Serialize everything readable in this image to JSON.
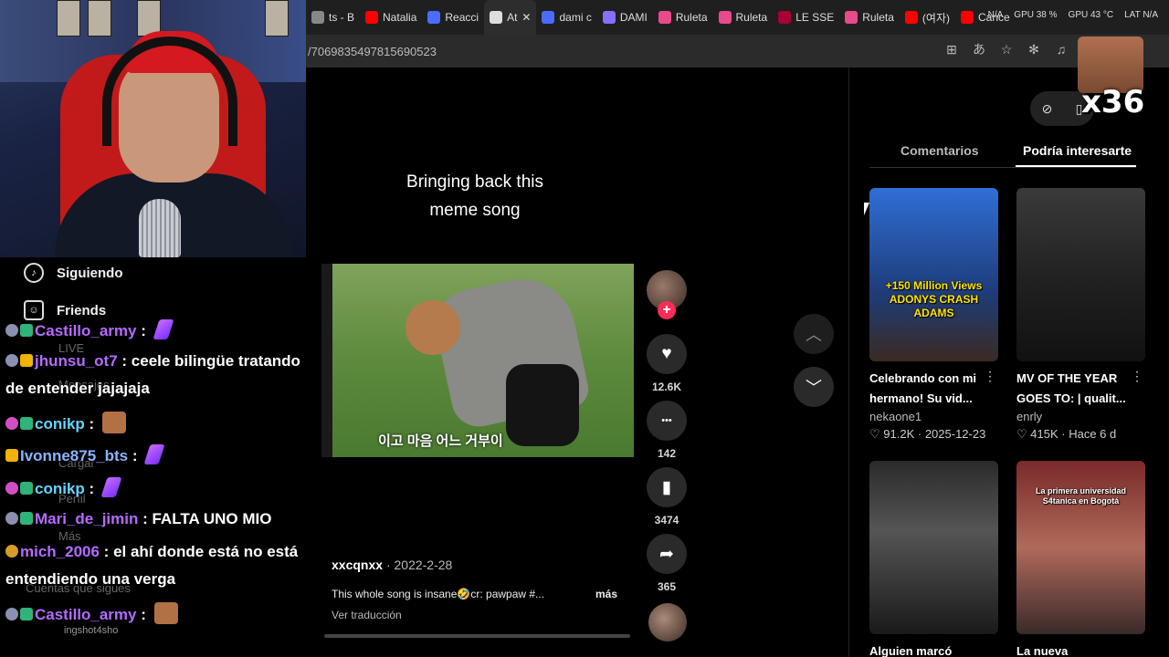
{
  "browser": {
    "tabs": [
      {
        "label": "ts - B",
        "color": "#888888"
      },
      {
        "label": "Natalia",
        "color": "#ff0000"
      },
      {
        "label": "Reacci",
        "color": "#4a6cff"
      },
      {
        "label": "At",
        "color": "#dddddd"
      },
      {
        "label": "dami c",
        "color": "#4a6cff"
      },
      {
        "label": "DAMI",
        "color": "#8a6cff"
      },
      {
        "label": "Ruleta",
        "color": "#e84a8c"
      },
      {
        "label": "Ruleta",
        "color": "#e84a8c"
      },
      {
        "label": "LE SSE",
        "color": "#aa0033"
      },
      {
        "label": "Ruleta",
        "color": "#e84a8c"
      },
      {
        "label": "(여자)",
        "color": "#ff0000"
      },
      {
        "label": "Cance",
        "color": "#ff0000"
      }
    ],
    "stats": [
      "N/A",
      "GPU 38 %",
      "GPU 43 °C",
      "LAT N/A"
    ],
    "url": "/7069835497815690523"
  },
  "sidebar": {
    "items": [
      {
        "label": "Siguiendo",
        "icon": "tiktok-icon"
      },
      {
        "label": "Friends",
        "icon": "friends-icon"
      }
    ],
    "ghost_items": [
      "LIVE",
      "Mensajes",
      "Cargar",
      "Perfil",
      "Más",
      "Cuentas que sigues",
      "ingshot4sho"
    ]
  },
  "chat": {
    "messages": [
      {
        "user": "Castillo_army",
        "text": "",
        "user_class": "user-purple",
        "badges": [
          "b1",
          "b2"
        ],
        "emote": "slash"
      },
      {
        "user": "jhunsu_ot7",
        "text": "ceele bilingüe tratando",
        "continuation": "de entender jajajaja",
        "user_class": "user-purple",
        "badges": [
          "b1",
          "b3"
        ]
      },
      {
        "user": "conikp",
        "text": "",
        "user_class": "user-teal",
        "badges": [
          "b4",
          "b2"
        ],
        "emote": "face"
      },
      {
        "user": "Ivonne875_bts",
        "text": "",
        "user_class": "user-blue",
        "badges": [
          "b3"
        ],
        "emote": "slash"
      },
      {
        "user": "conikp",
        "text": "",
        "user_class": "user-teal",
        "badges": [
          "b4",
          "b2"
        ],
        "emote": "slash"
      },
      {
        "user": "Mari_de_jimin",
        "text": "FALTA UNO MIO",
        "user_class": "user-purple",
        "badges": [
          "b1",
          "b2"
        ]
      },
      {
        "user": "mich_2006",
        "text": "el ahí donde está no está",
        "continuation": "entendiendo una verga",
        "user_class": "user-purple",
        "badges": [
          "b5"
        ]
      },
      {
        "user": "Castillo_army",
        "text": "",
        "user_class": "user-purple",
        "badges": [
          "b1",
          "b2"
        ],
        "emote": "face"
      }
    ]
  },
  "video": {
    "caption_line1": "Bringing back this",
    "caption_line2": "meme song",
    "subtitle": "이고 마음 어느 거부이",
    "author": "xxcqnxx",
    "date": "2022-2-28",
    "description": "This whole song is insane🤣cr: pawpaw #...",
    "more_label": "más",
    "translate_label": "Ver traducción",
    "actions": [
      {
        "icon": "heart-icon",
        "glyph": "♥",
        "count": "12.6K"
      },
      {
        "icon": "comment-icon",
        "glyph": "•••",
        "count": "142"
      },
      {
        "icon": "bookmark-icon",
        "glyph": "▮",
        "count": "3474"
      },
      {
        "icon": "share-icon",
        "glyph": "➦",
        "count": "365"
      }
    ],
    "follow_glyph": "+"
  },
  "panel": {
    "tab_comments": "Comentarios",
    "tab_related": "Podría interesarte",
    "badge_count": "x36",
    "cards": [
      {
        "title": "Celebrando con mi hermano! Su vid...",
        "author": "nekaone1",
        "likes": "91.2K",
        "date": "2025-12-23",
        "thumb_text": "+150 Million Views ADONYS CRASH ADAMS",
        "bg": "linear-gradient(180deg,#2f6fd6,#1e3c7a 60%,#3a2a22)"
      },
      {
        "title": "MV OF THE YEAR GOES TO: | qualit...",
        "author": "enrly",
        "likes": "415K",
        "date": "Hace 6 d",
        "thumb_text": "",
        "bg": "linear-gradient(180deg,#3a3a3a,#222 50%,#111)"
      },
      {
        "title": "Alguien marcó",
        "author": "",
        "likes": "",
        "date": "",
        "thumb_text": "",
        "bg": "linear-gradient(180deg,#2a2a2a,#555 40%,#1a1a1a)"
      },
      {
        "title": "La nueva",
        "author": "",
        "likes": "",
        "date": "",
        "thumb_text": "La primera universidad S4tanica en Bogotá",
        "bg": "linear-gradient(180deg,#7a2a2a,#b06a5a 50%,#3a2a2a)"
      }
    ]
  }
}
